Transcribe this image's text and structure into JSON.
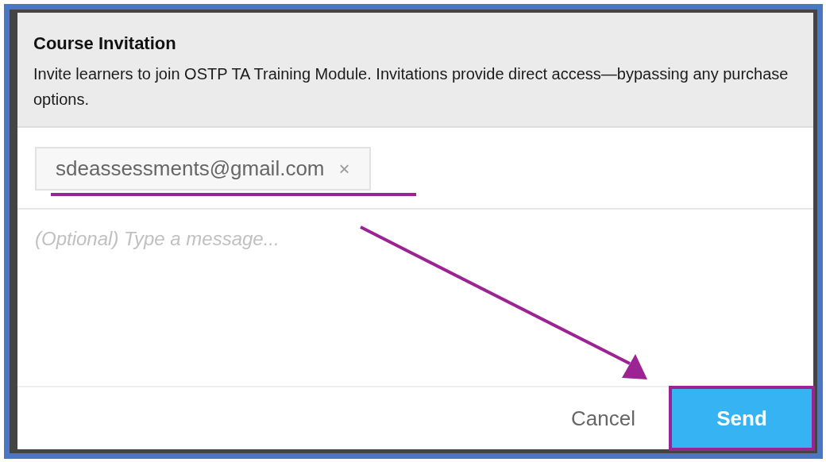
{
  "dialog": {
    "title": "Course Invitation",
    "description": "Invite learners to join OSTP TA Training Module. Invitations provide direct access—bypassing any purchase options."
  },
  "recipients": [
    {
      "email": "sdeassessments@gmail.com",
      "remove": "×",
      "underlined": true
    }
  ],
  "message": {
    "placeholder": "(Optional) Type a message..."
  },
  "buttons": [
    {
      "kind": "cancel",
      "label": "Cancel",
      "highlighted": false
    },
    {
      "kind": "send",
      "label": "Send",
      "highlighted": true
    }
  ],
  "annotation_arrow": true
}
